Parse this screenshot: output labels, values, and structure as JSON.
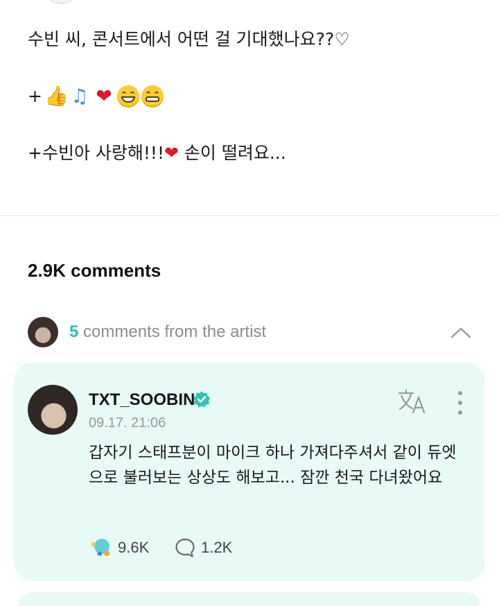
{
  "post": {
    "line1": "수빈 씨, 콘서트에서 어떤 걸 기대했나요??♡",
    "line2_prefix": "+",
    "line3": "+수빈아 사랑해!!!",
    "line3_suffix": " 손이 떨려요..."
  },
  "comments_header": {
    "count_text": "2.9K comments"
  },
  "artist_comments": {
    "count": "5",
    "label": " comments from the artist"
  },
  "comment": {
    "author": "TXT_SOOBIN",
    "timestamp": "09.17. 21:06",
    "text": "갑자기 스태프분이 마이크 하나 가져다주셔서 같이 듀엣으로 불러보는 상상도 해보고... 잠깐 천국 다녀왔어요",
    "likes": "9.6K",
    "replies": "1.2K"
  },
  "icons": {
    "verified": "verified-badge-icon",
    "translate": "translate-icon",
    "more": "more-vertical-icon",
    "like": "weverse-like-icon",
    "reply": "reply-bubble-icon",
    "collapse": "chevron-up-icon"
  },
  "colors": {
    "accent": "#2bbfb3",
    "card_bg": "#e7faf6",
    "heart": "#e0182a"
  }
}
